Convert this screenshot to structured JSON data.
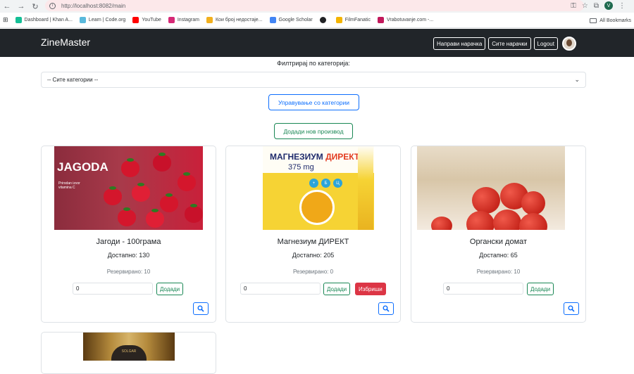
{
  "browser": {
    "url": "http://localhost:8082/main",
    "account_initial": "V",
    "bookmarks": [
      {
        "label": "Dashboard | Khan A...",
        "color": "#14bf96"
      },
      {
        "label": "Learn | Code.org",
        "color": "#59b9dc"
      },
      {
        "label": "YouTube",
        "color": "#ff0000"
      },
      {
        "label": "Instagram",
        "color": "#d62976"
      },
      {
        "label": "Кои број недостаје...",
        "color": "#f2b01e"
      },
      {
        "label": "Google Scholar",
        "color": "#4285f4"
      },
      {
        "label": "",
        "color": "#202124"
      },
      {
        "label": "FilmFanatic",
        "color": "#f4b400"
      },
      {
        "label": "Vrabotuvanje.com -...",
        "color": "#c2185b"
      }
    ],
    "all_bookmarks": "All Bookmarks"
  },
  "navbar": {
    "brand": "ZineMaster",
    "create_order": "Направи нарачка",
    "all_orders": "Сите нарачки",
    "logout": "Logout"
  },
  "filter": {
    "label": "Филтрирај по категорија:",
    "selected": "-- Сите категории --"
  },
  "actions": {
    "manage_categories": "Управување со категории",
    "add_product": "Додади нов производ"
  },
  "products": [
    {
      "name": "Јагоди - 100грама",
      "available": "Достапно: 130",
      "reserved": "Резервирано: 10",
      "qty": "0",
      "add": "Додади",
      "image_text": "JAGODA",
      "image_small": "Prirodan izvor vitamina C"
    },
    {
      "name": "Магнезиум ДИРЕКТ",
      "available": "Достапно: 205",
      "reserved": "Резервирано: 0",
      "qty": "0",
      "add": "Додади",
      "delete": "Избриши",
      "image_title_a": "МАГНЕЗИУМ",
      "image_title_b": "ДИРЕКТ",
      "image_dose": "375 mg"
    },
    {
      "name": "Органски домат",
      "available": "Достапно: 65",
      "reserved": "Резервирано: 10",
      "qty": "0",
      "add": "Додади"
    }
  ],
  "bottle": {
    "brand": "SOLGAR"
  },
  "colors": {
    "navbar": "#212529",
    "primary": "#0d6efd",
    "success": "#198754",
    "danger": "#dc3545"
  }
}
